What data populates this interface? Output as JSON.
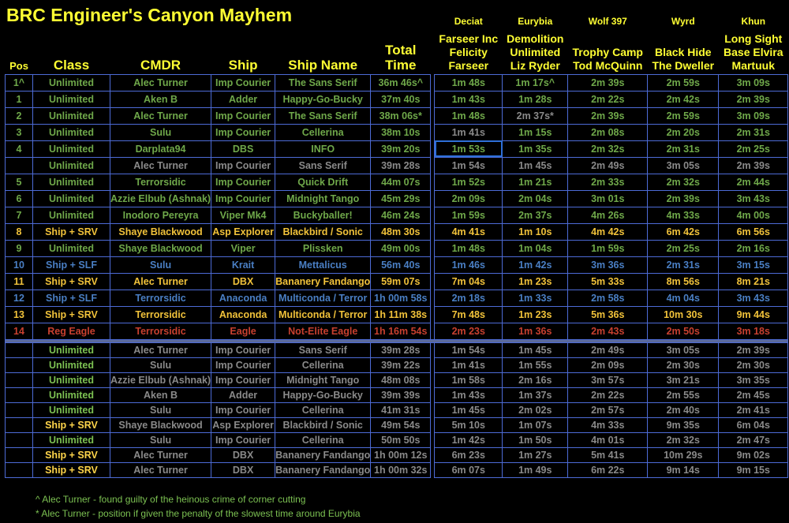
{
  "title": "BRC Engineer's Canyon Mayhem",
  "headers": {
    "pos": "Pos",
    "class": "Class",
    "cmdr": "CMDR",
    "ship": "Ship",
    "ship_name": "Ship Name",
    "total_line1": "Total",
    "total_line2": "Time",
    "stages": [
      {
        "planet": "Deciat",
        "station": [
          "Farseer Inc",
          "Felicity",
          "Farseer"
        ]
      },
      {
        "planet": "Eurybia",
        "station": [
          "Demolition",
          "Unlimited",
          "Liz Ryder"
        ]
      },
      {
        "planet": "Wolf 397",
        "station": [
          "",
          "Trophy Camp",
          "Tod McQuinn"
        ]
      },
      {
        "planet": "Wyrd",
        "station": [
          "",
          "Black Hide",
          "The Dweller"
        ]
      },
      {
        "planet": "Khun",
        "station": [
          "Long Sight",
          "Base Elvira",
          "Martuuk"
        ]
      }
    ]
  },
  "colors": {
    "green": "#6fa84a",
    "gold": "#f1c23a",
    "blue": "#4a7fc4",
    "red": "#c8402f",
    "grey": "#8a8a8a",
    "grid": "#4d6bd6",
    "header": "#ffff33"
  },
  "rows": [
    {
      "style": "green",
      "cells": [
        "1^",
        "Unlimited",
        "Alec Turner",
        "Imp Courier",
        "The Sans Serif",
        "36m 46s^",
        "1m 48s",
        "1m 17s^",
        "2m 39s",
        "2m 59s",
        "3m 09s"
      ],
      "grey": []
    },
    {
      "style": "green",
      "cells": [
        "1",
        "Unlimited",
        "Aken B",
        "Adder",
        "Happy-Go-Bucky",
        "37m 40s",
        "1m 43s",
        "1m 28s",
        "2m 22s",
        "2m 42s",
        "2m 39s"
      ],
      "grey": []
    },
    {
      "style": "green",
      "cells": [
        "2",
        "Unlimited",
        "Alec Turner",
        "Imp Courier",
        "The Sans Serif",
        "38m 06s*",
        "1m 48s",
        "2m 37s*",
        "2m 39s",
        "2m 59s",
        "3m 09s"
      ],
      "grey": [
        7
      ]
    },
    {
      "style": "green",
      "cells": [
        "3",
        "Unlimited",
        "Sulu",
        "Imp Courier",
        "Cellerina",
        "38m 10s",
        "1m 41s",
        "1m 15s",
        "2m 08s",
        "2m 20s",
        "2m 31s"
      ],
      "grey": [
        6
      ]
    },
    {
      "style": "green",
      "cells": [
        "4",
        "Unlimited",
        "Darplata94",
        "DBS",
        "INFO",
        "39m 20s",
        "1m 53s",
        "1m 35s",
        "2m 32s",
        "2m 31s",
        "2m 25s"
      ],
      "grey": [],
      "selected": 6
    },
    {
      "style": "green",
      "cells": [
        "",
        "Unlimited",
        "Alec Turner",
        "Imp Courier",
        "Sans Serif",
        "39m 28s",
        "1m 54s",
        "1m 45s",
        "2m 49s",
        "3m 05s",
        "2m 39s"
      ],
      "grey": [
        2,
        3,
        4,
        5,
        6,
        7,
        8,
        9,
        10
      ]
    },
    {
      "style": "green",
      "cells": [
        "5",
        "Unlimited",
        "Terrorsidic",
        "Imp Courier",
        "Quick Drift",
        "44m 07s",
        "1m 52s",
        "1m 21s",
        "2m 33s",
        "2m 32s",
        "2m 44s"
      ],
      "grey": []
    },
    {
      "style": "green",
      "cells": [
        "6",
        "Unlimited",
        "Azzie Elbub (Ashnak)",
        "Imp Courier",
        "Midnight Tango",
        "45m 29s",
        "2m 09s",
        "2m 04s",
        "3m 01s",
        "2m 39s",
        "3m 43s"
      ],
      "grey": []
    },
    {
      "style": "green",
      "cells": [
        "7",
        "Unlimited",
        "Inodoro Pereyra",
        "Viper Mk4",
        "Buckyballer!",
        "46m 24s",
        "1m 59s",
        "2m 37s",
        "4m 26s",
        "4m 33s",
        "4m 00s"
      ],
      "grey": []
    },
    {
      "style": "gold",
      "cells": [
        "8",
        "Ship + SRV",
        "Shaye Blackwood",
        "Asp Explorer",
        "Blackbird / Sonic",
        "48m 30s",
        "4m 41s",
        "1m 10s",
        "4m 42s",
        "6m 42s",
        "6m 56s"
      ],
      "grey": []
    },
    {
      "style": "green",
      "cells": [
        "9",
        "Unlimited",
        "Shaye Blackwood",
        "Viper",
        "Plissken",
        "49m 00s",
        "1m 48s",
        "1m 04s",
        "1m 59s",
        "2m 25s",
        "2m 16s"
      ],
      "grey": []
    },
    {
      "style": "blue",
      "cells": [
        "10",
        "Ship + SLF",
        "Sulu",
        "Krait",
        "Mettalicus",
        "56m 40s",
        "1m 46s",
        "1m 42s",
        "3m 36s",
        "2m 31s",
        "3m 15s"
      ],
      "grey": []
    },
    {
      "style": "gold",
      "cells": [
        "11",
        "Ship + SRV",
        "Alec Turner",
        "DBX",
        "Bananery Fandango",
        "59m 07s",
        "7m 04s",
        "1m 23s",
        "5m 33s",
        "8m 56s",
        "8m 21s"
      ],
      "grey": []
    },
    {
      "style": "blue",
      "cells": [
        "12",
        "Ship + SLF",
        "Terrorsidic",
        "Anaconda",
        "Multiconda / Terror",
        "1h 00m 58s",
        "2m 18s",
        "1m 33s",
        "2m 58s",
        "4m 04s",
        "3m 43s"
      ],
      "grey": []
    },
    {
      "style": "gold",
      "cells": [
        "13",
        "Ship + SRV",
        "Terrorsidic",
        "Anaconda",
        "Multiconda / Terror",
        "1h 11m 38s",
        "7m 48s",
        "1m 23s",
        "5m 36s",
        "10m 30s",
        "9m 44s"
      ],
      "grey": []
    },
    {
      "style": "red",
      "cells": [
        "14",
        "Reg Eagle",
        "Terrorsidic",
        "Eagle",
        "Not-Elite Eagle",
        "1h 16m 54s",
        "2m 23s",
        "1m 36s",
        "2m 43s",
        "2m 50s",
        "3m 18s"
      ],
      "grey": []
    }
  ],
  "lower_rows": [
    {
      "style": "cls-green",
      "cells": [
        "",
        "Unlimited",
        "Alec Turner",
        "Imp Courier",
        "Sans Serif",
        "39m 28s",
        "1m 54s",
        "1m 45s",
        "2m 49s",
        "3m 05s",
        "2m 39s"
      ]
    },
    {
      "style": "cls-green",
      "cells": [
        "",
        "Unlimited",
        "Sulu",
        "Imp Courier",
        "Cellerina",
        "39m 22s",
        "1m 41s",
        "1m 55s",
        "2m 09s",
        "2m 30s",
        "2m 30s"
      ]
    },
    {
      "style": "cls-green",
      "cells": [
        "",
        "Unlimited",
        "Azzie Elbub (Ashnak)",
        "Imp Courier",
        "Midnight Tango",
        "48m 08s",
        "1m 58s",
        "2m 16s",
        "3m 57s",
        "3m 21s",
        "3m 35s"
      ]
    },
    {
      "style": "cls-green",
      "cells": [
        "",
        "Unlimited",
        "Aken B",
        "Adder",
        "Happy-Go-Bucky",
        "39m 39s",
        "1m 43s",
        "1m 37s",
        "2m 22s",
        "2m 55s",
        "2m 45s"
      ]
    },
    {
      "style": "cls-green",
      "cells": [
        "",
        "Unlimited",
        "Sulu",
        "Imp Courier",
        "Cellerina",
        "41m 31s",
        "1m 45s",
        "2m 02s",
        "2m 57s",
        "2m 40s",
        "2m 41s"
      ]
    },
    {
      "style": "cls-gold",
      "cells": [
        "",
        "Ship + SRV",
        "Shaye Blackwood",
        "Asp Explorer",
        "Blackbird / Sonic",
        "49m 54s",
        "5m 10s",
        "1m 07s",
        "4m 33s",
        "9m 35s",
        "6m 04s"
      ]
    },
    {
      "style": "cls-green",
      "cells": [
        "",
        "Unlimited",
        "Sulu",
        "Imp Courier",
        "Cellerina",
        "50m 50s",
        "1m 42s",
        "1m 50s",
        "4m 01s",
        "2m 32s",
        "2m 47s"
      ]
    },
    {
      "style": "cls-gold",
      "cells": [
        "",
        "Ship + SRV",
        "Alec Turner",
        "DBX",
        "Bananery Fandango",
        "1h 00m 12s",
        "6m 23s",
        "1m 27s",
        "5m 41s",
        "10m 29s",
        "9m 02s"
      ]
    },
    {
      "style": "cls-gold",
      "cells": [
        "",
        "Ship + SRV",
        "Alec Turner",
        "DBX",
        "Bananery Fandango",
        "1h 00m 32s",
        "6m 07s",
        "1m 49s",
        "6m 22s",
        "9m 14s",
        "9m 15s"
      ]
    }
  ],
  "footnotes": [
    "^ Alec Turner - found guilty of the heinous crime of corner cutting",
    "* Alec Turner - position if given the penalty of the slowest time around Eurybia"
  ]
}
